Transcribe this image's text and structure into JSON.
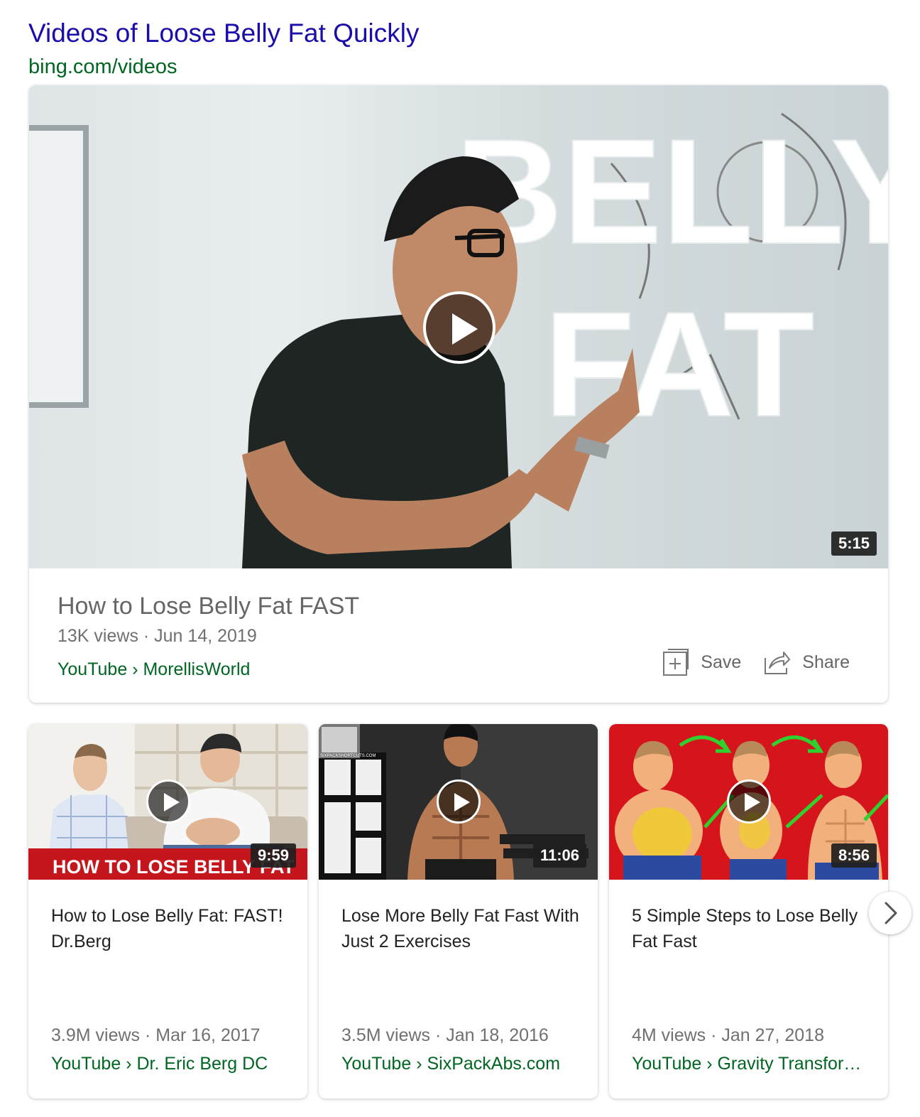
{
  "header": {
    "title": "Videos of Loose Belly Fat Quickly",
    "source": "bing.com/videos"
  },
  "featured": {
    "thumbnail_text_line1": "BELLY",
    "thumbnail_text_line2": "FAT",
    "duration": "5:15",
    "title": "How to Lose Belly Fat FAST",
    "meta": "13K views · Jun 14, 2019",
    "channel": "YouTube › MorellisWorld",
    "save_label": "Save",
    "share_label": "Share"
  },
  "videos": [
    {
      "thumbnail_caption": "HOW TO LOSE BELLY FAT",
      "duration": "9:59",
      "title": "How to Lose Belly Fat: FAST! Dr.Berg",
      "meta": "3.9M views · Mar 16, 2017",
      "channel": "YouTube › Dr. Eric Berg DC"
    },
    {
      "thumbnail_caption": "SIXPACKSHORTCUTS.COM",
      "duration": "11:06",
      "title": "Lose More Belly Fat Fast With Just 2 Exercises",
      "meta": "3.5M views · Jan 18, 2016",
      "channel": "YouTube › SixPackAbs.com"
    },
    {
      "duration": "8:56",
      "title": "5 Simple Steps to Lose Belly Fat Fast",
      "meta": "4M views · Jan 27, 2018",
      "channel": "YouTube › Gravity Transfor…"
    }
  ],
  "icons": {
    "play": "play-icon",
    "save": "plus-square-icon",
    "share": "share-arrow-icon",
    "next": "chevron-right-icon"
  },
  "colors": {
    "title_link": "#1a0dab",
    "url_green": "#006621",
    "thumb_red": "#c4161c"
  }
}
